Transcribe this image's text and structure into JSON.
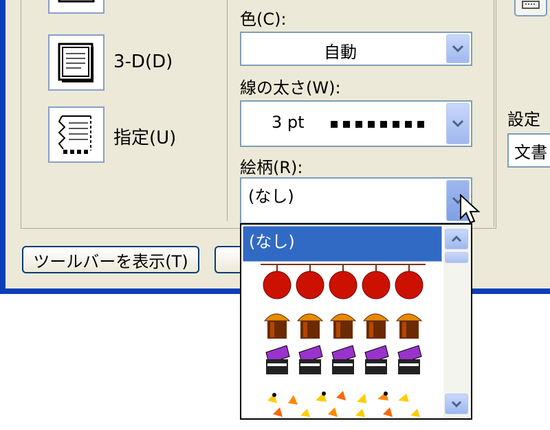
{
  "borders": {
    "box_3d_label": "3-D(D)",
    "custom_label": "指定(U)"
  },
  "line": {
    "color_label": "色(C):",
    "color_value": "自動",
    "width_label": "線の太さ(W):",
    "width_value": "3 pt",
    "art_label": "絵柄(R):",
    "art_value": "(なし)"
  },
  "right_panel": {
    "setting_label": "設定",
    "document_value": "文書"
  },
  "buttons": {
    "show_toolbar": "ツールバーを表示(T)"
  },
  "art_dropdown": {
    "selected_option": "(なし)",
    "options": [
      "red-apples-art",
      "cupcake-art",
      "gift-box-art",
      "candy-corn-art"
    ]
  },
  "colors": {
    "selection": "#316ac5",
    "window_frame": "#0a3fb8",
    "dialog_bg": "#ece9d8"
  }
}
